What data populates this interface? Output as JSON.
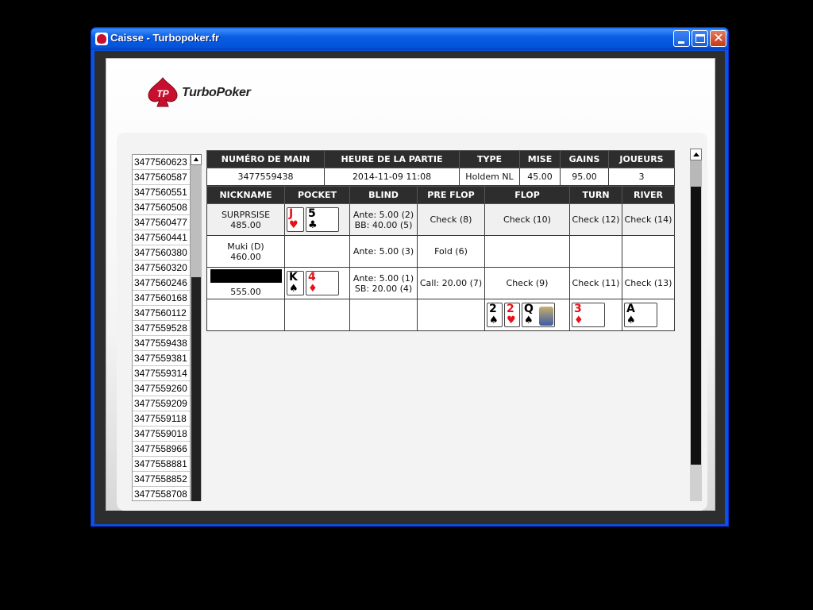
{
  "window": {
    "title": "Caisse - Turbopoker.fr"
  },
  "logo": {
    "text": "TurboPoker",
    "badge": "TP"
  },
  "hand_list": [
    "3477560623",
    "3477560587",
    "3477560551",
    "3477560508",
    "3477560477",
    "3477560441",
    "3477560380",
    "3477560320",
    "3477560246",
    "3477560168",
    "3477560112",
    "3477559528",
    "3477559438",
    "3477559381",
    "3477559314",
    "3477559260",
    "3477559209",
    "3477559118",
    "3477559018",
    "3477558966",
    "3477558881",
    "3477558852",
    "3477558708"
  ],
  "summary": {
    "headers": [
      "NUMÉRO DE MAIN",
      "HEURE DE LA PARTIE",
      "TYPE",
      "MISE",
      "GAINS",
      "JOUEURS"
    ],
    "values": [
      "3477559438",
      "2014-11-09 11:08",
      "Holdem NL",
      "45.00",
      "95.00",
      "3"
    ]
  },
  "detail": {
    "headers": [
      "NICKNAME",
      "POCKET",
      "BLIND",
      "PRE FLOP",
      "FLOP",
      "TURN",
      "RIVER"
    ],
    "rows": [
      {
        "name": "SURPRSISE",
        "stack": "485.00",
        "blind1": "Ante: 5.00 (2)",
        "blind2": "BB: 40.00 (5)",
        "preflop": "Check (8)",
        "flop": "Check (10)",
        "turn": "Check (12)",
        "river": "Check (14)",
        "pocket": [
          {
            "rank": "J",
            "suit": "♥",
            "color": "#e8101a"
          },
          {
            "rank": "5",
            "suit": "♣",
            "color": "#000000"
          }
        ]
      },
      {
        "name": "Muki (D)",
        "stack": "460.00",
        "blind1": "Ante: 5.00 (3)",
        "preflop": "Fold (6)"
      },
      {
        "stack": "555.00",
        "blind1": "Ante: 5.00 (1)",
        "blind2": "SB: 20.00 (4)",
        "preflop": "Call: 20.00 (7)",
        "flop": "Check (9)",
        "turn": "Check (11)",
        "river": "Check (13)",
        "pocket": [
          {
            "rank": "K",
            "suit": "♠",
            "color": "#000000"
          },
          {
            "rank": "4",
            "suit": "♦",
            "color": "#e8101a"
          }
        ]
      }
    ],
    "board": {
      "flop": [
        {
          "rank": "2",
          "suit": "♠"
        },
        {
          "rank": "2",
          "suit": "♥"
        },
        {
          "rank": "Q",
          "suit": "♠"
        }
      ],
      "turn": {
        "rank": "3",
        "suit": "♦"
      },
      "river": {
        "rank": "A",
        "suit": "♠"
      }
    }
  }
}
